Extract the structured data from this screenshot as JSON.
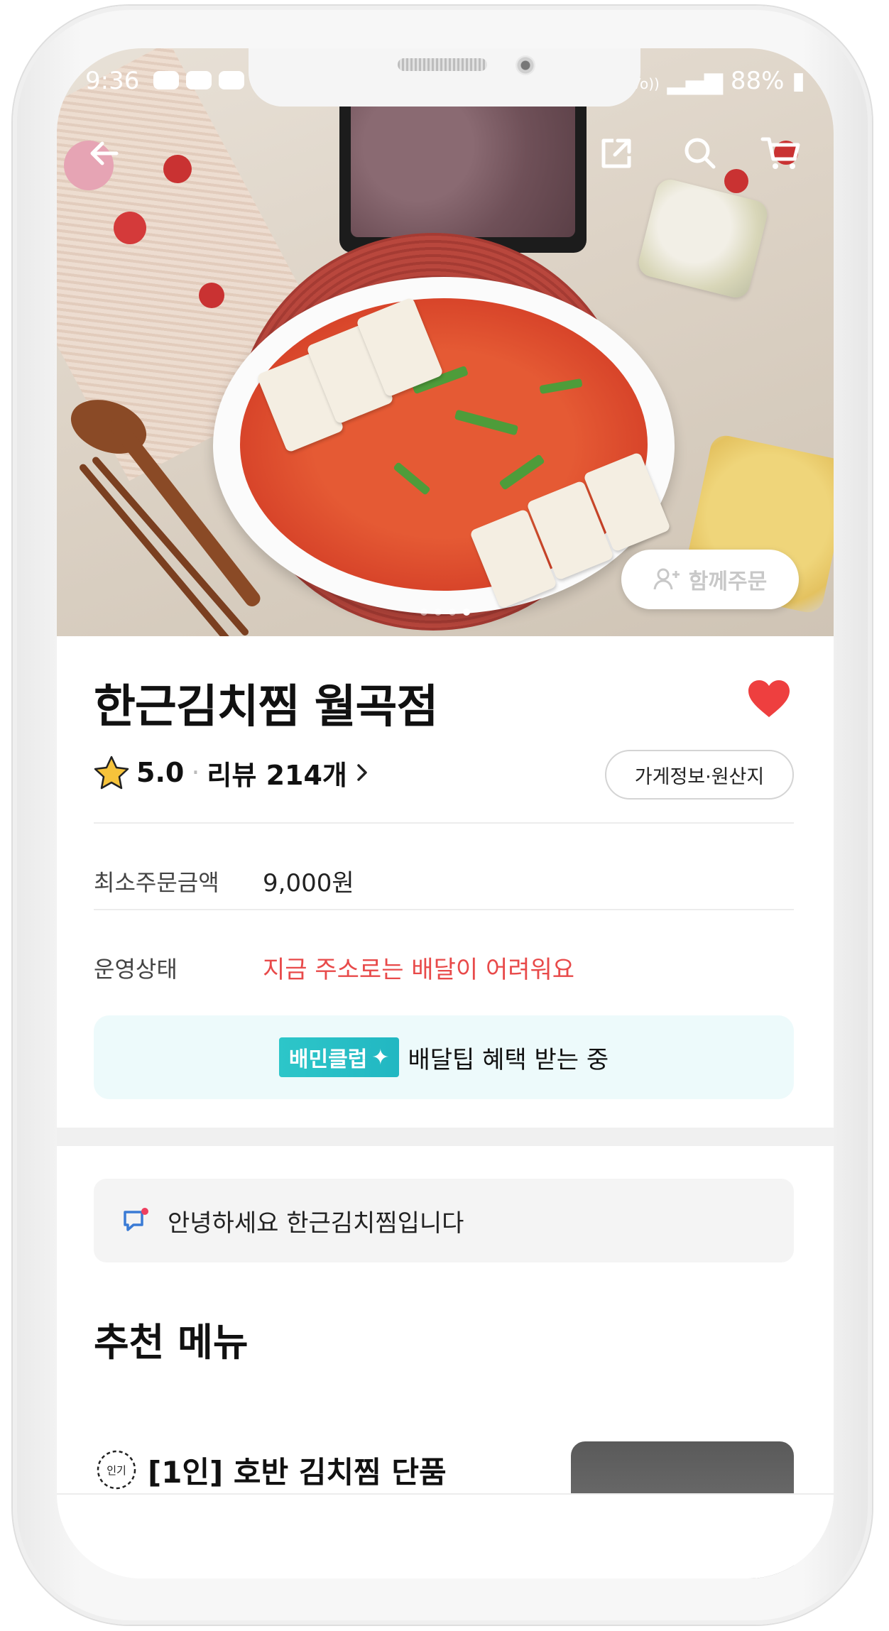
{
  "status_bar": {
    "time": "9:36",
    "carrier": "Vo))",
    "battery": "88%"
  },
  "hero": {
    "group_order_label": "함께주문",
    "active_slide": 3,
    "slide_count": 4
  },
  "store": {
    "name": "한근김치찜 월곡점",
    "favorite": true,
    "rating": "5.0",
    "reviews_label": "리뷰 214개",
    "info_button": "가게정보·원산지"
  },
  "details": {
    "min_order_label": "최소주문금액",
    "min_order_value": "9,000원",
    "status_label": "운영상태",
    "status_value": "지금 주소로는 배달이 어려워요"
  },
  "club": {
    "badge": "배민클럽",
    "text": "배달팁 혜택 받는 중"
  },
  "notice": {
    "text": "안녕하세요 한근김치찜입니다"
  },
  "recommended": {
    "title": "추천 메뉴",
    "items": [
      {
        "badge": "인기",
        "name": "[1인] 호반 김치찜 단품"
      }
    ]
  },
  "colors": {
    "accent_red": "#e84a4a",
    "club_teal": "#2dc6c9",
    "heart": "#ee3f3f"
  }
}
